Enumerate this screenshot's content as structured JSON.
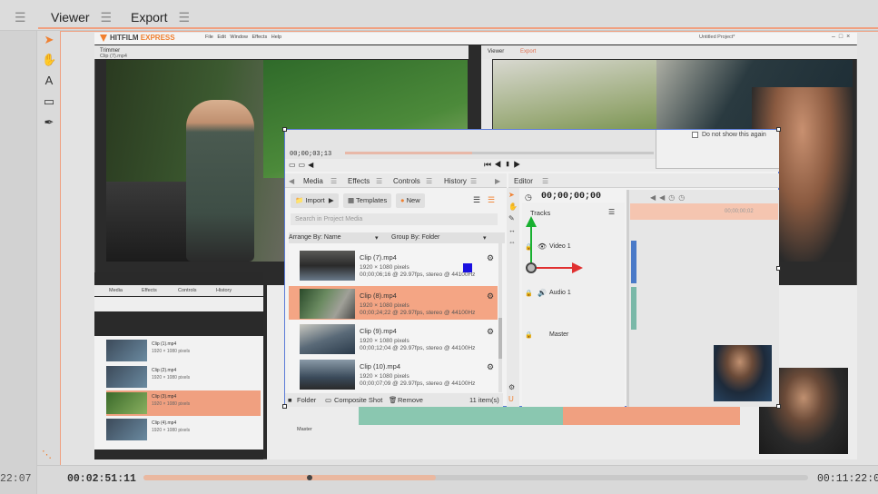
{
  "outer": {
    "tabs": [
      {
        "label": "Viewer",
        "active": true
      },
      {
        "label": "Export",
        "active": false
      }
    ],
    "timecode_left_cut": "22:07",
    "timecode_current": "00:02:51:11",
    "timecode_end": "00:11:22:07",
    "playhead_progress": 0.25,
    "accent_color": "#f0a080"
  },
  "tools": [
    {
      "icon": "select-arrow-icon",
      "glyph": "➤"
    },
    {
      "icon": "hand-pan-icon",
      "glyph": "✋"
    },
    {
      "icon": "text-tool-icon",
      "glyph": "A"
    },
    {
      "icon": "rectangle-mask-icon",
      "glyph": "▭"
    },
    {
      "icon": "pen-tool-icon",
      "glyph": "✒"
    }
  ],
  "inner": {
    "brand_main": "HITFILM",
    "brand_accent": "EXPRESS",
    "menu": "File Edit Window Effects Help",
    "project_title": "Untitled Project*",
    "trimmer_label": "Trimmer",
    "trimmer_clip": "Clip (7).mp4",
    "viewer_label": "Viewer",
    "export_label": "Export",
    "media_tabs": [
      "Media",
      "Effects",
      "Controls",
      "History"
    ],
    "master_label": "Master",
    "rows": [
      {
        "name": "Clip (1).mp4",
        "meta": "1920 × 1080 pixels"
      },
      {
        "name": "Clip (2).mp4",
        "meta": "1920 × 1080 pixels"
      },
      {
        "name": "Clip (3).mp4",
        "meta": "1920 × 1080 pixels"
      },
      {
        "name": "Clip (4).mp4",
        "meta": "1920 × 1080 pixels"
      }
    ]
  },
  "overlay": {
    "viewer_timecode": "00;00;03;13",
    "dialog_checkbox_label": "Do not show this again",
    "tabs": [
      "Media",
      "Effects",
      "Controls",
      "History"
    ],
    "editor_tab": "Editor",
    "buttons": {
      "import": "Import",
      "templates": "Templates",
      "new": "New"
    },
    "search_placeholder": "Search in Project Media",
    "arrange_by": "Arrange By: Name",
    "group_by": "Group By: Folder",
    "clips": [
      {
        "name": "Clip (7).mp4",
        "dims": "1920 × 1080 pixels",
        "info": "00;00;06;16 @ 29.97fps, stereo @ 44100Hz",
        "selected": false
      },
      {
        "name": "Clip (8).mp4",
        "dims": "1920 × 1080 pixels",
        "info": "00;00;24;22 @ 29.97fps, stereo @ 44100Hz",
        "selected": true
      },
      {
        "name": "Clip (9).mp4",
        "dims": "1920 × 1080 pixels",
        "info": "00;00;12;04 @ 29.97fps, stereo @ 44100Hz",
        "selected": false
      },
      {
        "name": "Clip (10).mp4",
        "dims": "1920 × 1080 pixels",
        "info": "00;00;07;09 @ 29.97fps, stereo @ 44100Hz",
        "selected": false
      }
    ],
    "bottom": {
      "folder": "Folder",
      "composite": "Composite Shot",
      "remove": "Remove",
      "count": "11 item(s)"
    },
    "editor_timecode": "00;00;00;00",
    "tracks_label": "Tracks",
    "track_video": "Video 1",
    "track_audio": "Audio 1",
    "track_master": "Master",
    "ruler_tc": "00;00;00;02",
    "selection_color": "#5b7bd8"
  }
}
